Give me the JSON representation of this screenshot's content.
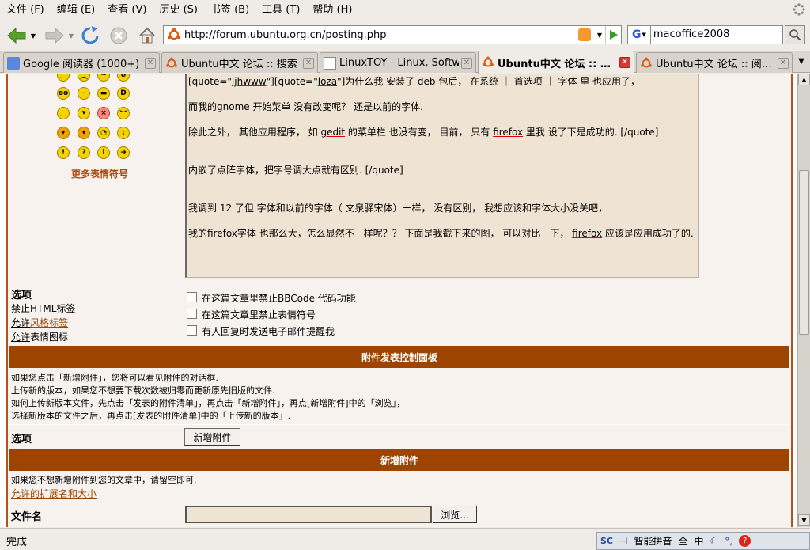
{
  "menu": [
    "文件 (F)",
    "编辑 (E)",
    "查看 (V)",
    "历史 (S)",
    "书签 (B)",
    "工具 (T)",
    "帮助 (H)"
  ],
  "nav": {
    "url": "http://forum.ubuntu.org.cn/posting.php",
    "search_value": "macoffice2008",
    "search_engine": "G"
  },
  "tabs": [
    {
      "label": "Google 阅读器 (1000+)",
      "active": false
    },
    {
      "label": "Ubuntu中文 论坛 :: 搜索",
      "active": false
    },
    {
      "label": "LinuxTOY - Linux, Softw…",
      "active": false
    },
    {
      "label": "Ubuntu中文 论坛 :: …",
      "active": true
    },
    {
      "label": "Ubuntu中文 论坛 :: 阅…",
      "active": false
    }
  ],
  "emoticons": {
    "more_label": "更多表情符号"
  },
  "message": {
    "line1_a": "[quote=\"",
    "line1_b": "ljhwww",
    "line1_c": "\"][quote=\"",
    "line1_d": "loza",
    "line1_e": "\"]为什么我 安装了 deb 包后， 在系统 ｜ 首选项 ｜ 字体 里 也应用了，",
    "line2": "而我的gnome 开始菜单 没有改变呢？  还是以前的字体.",
    "line3_a": "除此之外， 其他应用程序， 如 ",
    "line3_b": "gedit",
    "line3_c": " 的菜单栏 也没有变， 目前， 只有 ",
    "line3_d": "firefox",
    "line3_e": " 里我 设了下是成功的.  [/quote]",
    "line4": "－ － － － － － － － － － － － － － － － － － － － － － － － － － － － － － － － － － － － － － － － －",
    "line5": "内嵌了点阵字体，把字号调大点就有区别.  [/quote]",
    "line6": "我调到 12 了但 字体和以前的字体（ 文泉驿宋体）一样， 没有区别， 我想应该和字体大小没关吧，",
    "line7_a": "我的firefox字体 也那么大，怎么显然不一样呢？？ 下面是我截下来的图， 可以对比一下， ",
    "line7_b": "firefox",
    "line7_c": " 应该是应用成功了的."
  },
  "options": {
    "title": "选项",
    "html_prefix": "禁止",
    "html_suffix": "HTML标签",
    "bbcode_prefix": "允许",
    "bbcode_link": "风格标签",
    "smilies_prefix": "允许",
    "smilies_suffix": "表情图标",
    "chk1": "在这篇文章里禁止BBCode 代码功能",
    "chk2": "在这篇文章里禁止表情符号",
    "chk3": "有人回复时发送电子邮件提醒我"
  },
  "attach_panel": {
    "header": "附件发表控制面板",
    "info1": "如果您点击「新增附件」，您将可以看见附件的对话框.",
    "info2": "上传新的版本，如果您不想要下载次数被归零而更新原先旧版的文件.",
    "info3": "如何上传新版本文件，先点击「发表的附件清单」，再点击「新增附件」，再点[新增附件]中的「浏览」，",
    "info4": "选择新版本的文件之后，再点击[发表的附件清单]中的「上传新的版本」.",
    "options_label": "选项",
    "add_button": "新增附件"
  },
  "new_attach": {
    "header": "新增附件",
    "info": "如果您不想新增附件到您的文章中，请留空即可.",
    "link": "允许的扩展名和大小",
    "file_label": "文件名",
    "browse": "浏览..."
  },
  "status": {
    "text": "完成"
  },
  "ime": {
    "label1": "SC",
    "label2": "智能拼音",
    "label3": "全",
    "label4": "中"
  }
}
